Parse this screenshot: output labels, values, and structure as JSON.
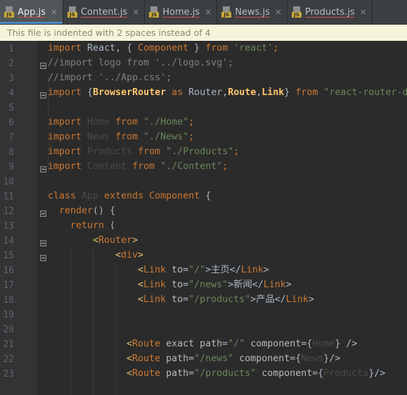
{
  "tabs": [
    {
      "label": "App.js",
      "active": true
    },
    {
      "label": "Content.js",
      "active": false
    },
    {
      "label": "Home.js",
      "active": false
    },
    {
      "label": "News.js",
      "active": false
    },
    {
      "label": "Products.js",
      "active": false
    }
  ],
  "tab_close_glyph": "×",
  "tab_file_badge": "JS",
  "notice": "This file is indented with 2 spaces instead of 4",
  "line_numbers": [
    "1",
    "2",
    "3",
    "4",
    "5",
    "6",
    "7",
    "8",
    "9",
    "10",
    "11",
    "12",
    "13",
    "14",
    "15",
    "16",
    "17",
    "18",
    "19",
    "20",
    "21",
    "22",
    "23"
  ],
  "code": {
    "l1": [
      "import",
      " React, { ",
      "Component",
      " } ",
      "from",
      " ",
      "'react'",
      ";"
    ],
    "l2": "//import logo from '../logo.svg';",
    "l3": "//import '../App.css';",
    "l4": [
      "import",
      " {",
      "BrowserRouter",
      " ",
      "as",
      " Router,",
      "Route",
      ",",
      "Link",
      "} ",
      "from",
      " ",
      "\"react-router-dom\""
    ],
    "l6": [
      "import",
      " ",
      "Home",
      " ",
      "from",
      " ",
      "\"./Home\"",
      ";"
    ],
    "l7": [
      "import",
      " ",
      "News",
      " ",
      "from",
      " ",
      "\"./News\"",
      ";"
    ],
    "l8": [
      "import",
      " ",
      "Products",
      " ",
      "from",
      " ",
      "\"./Products\"",
      ";"
    ],
    "l9": [
      "import",
      " ",
      "Content",
      " ",
      "from",
      " ",
      "\"./Content\"",
      ";"
    ],
    "l11": [
      "class",
      " ",
      "App",
      " ",
      "extends",
      " ",
      "Component",
      " {"
    ],
    "l12": [
      "render",
      "() {"
    ],
    "l13": [
      "return",
      " ("
    ],
    "l14": [
      "<",
      "Router",
      ">"
    ],
    "l15": [
      "<",
      "div",
      ">"
    ],
    "l16": [
      "<",
      "Link",
      " ",
      "to",
      "=",
      "\"/\"",
      ">主页</",
      "Link",
      ">"
    ],
    "l17": [
      "<",
      "Link",
      " ",
      "to",
      "=",
      "\"/news\"",
      ">新闻</",
      "Link",
      ">"
    ],
    "l18": [
      "<",
      "Link",
      " ",
      "to",
      "=",
      "\"/products\"",
      ">产品</",
      "Link",
      ">"
    ],
    "l21": [
      "<",
      "Route",
      " ",
      "exact",
      " ",
      "path",
      "=",
      "\"/\"",
      " ",
      "component",
      "={",
      "Home",
      "} />"
    ],
    "l22": [
      "<",
      "Route",
      " ",
      "path",
      "=",
      "\"/news\"",
      " ",
      "component",
      "={",
      "News",
      "}/>"
    ],
    "l23": [
      "<",
      "Route",
      " ",
      "path",
      "=",
      "\"/products\"",
      " ",
      "component",
      "={",
      "Products",
      "}/>"
    ]
  }
}
